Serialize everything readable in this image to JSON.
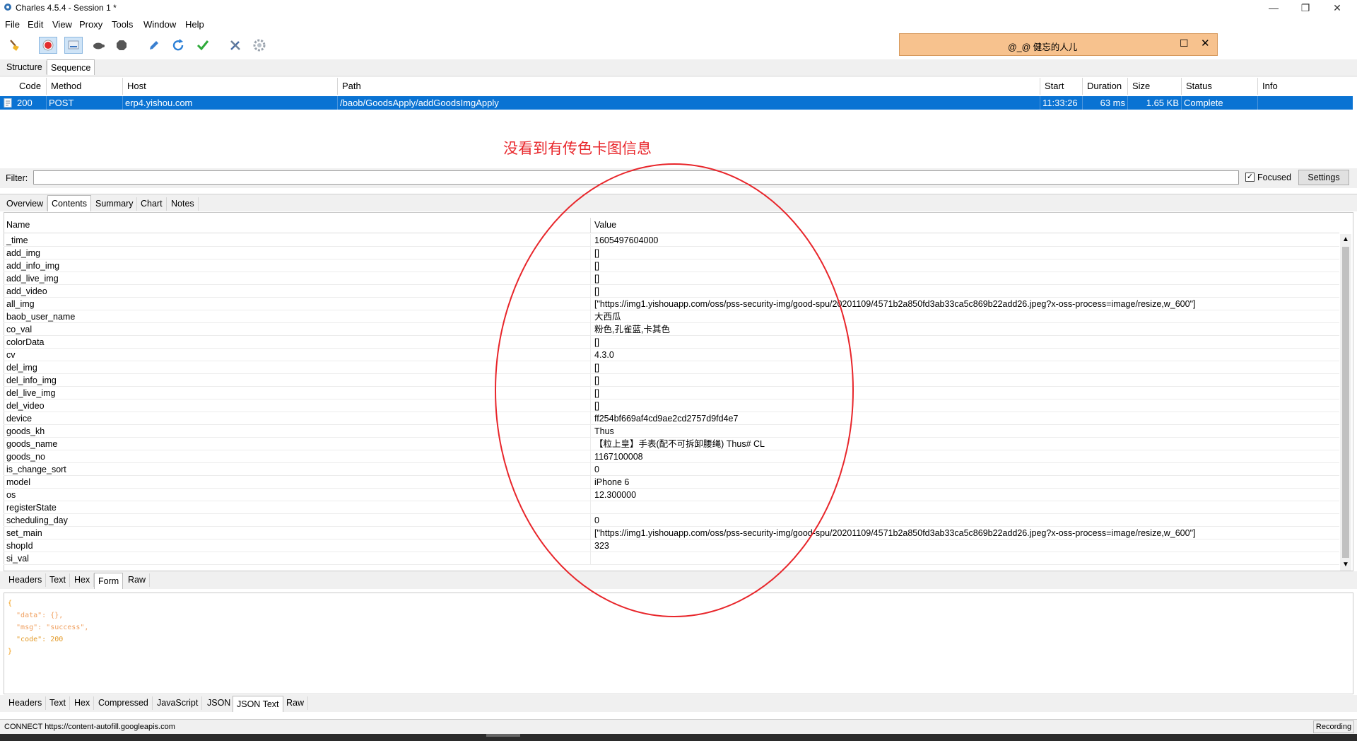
{
  "window": {
    "title": "Charles 4.5.4 - Session 1 *"
  },
  "menu": [
    "File",
    "Edit",
    "View",
    "Proxy",
    "Tools",
    "Window",
    "Help"
  ],
  "popup": {
    "text": "@_@   健忘的人儿"
  },
  "view_tabs": [
    "Structure",
    "Sequence"
  ],
  "table": {
    "headers": [
      "Code",
      "Method",
      "Host",
      "Path",
      "Start",
      "Duration",
      "Size",
      "Status",
      "Info"
    ],
    "row": {
      "code": "200",
      "method": "POST",
      "host": "erp4.yishou.com",
      "path": "/baob/GoodsApply/addGoodsImgApply",
      "start": "11:33:26",
      "duration": "63 ms",
      "size": "1.65 KB",
      "status": "Complete",
      "info": ""
    }
  },
  "annotation": {
    "text": "没看到有传色卡图信息",
    "color": "#e8262b"
  },
  "filter": {
    "label": "Filter:",
    "value": "",
    "focused_label": "Focused",
    "focused_checked": true,
    "settings_label": "Settings"
  },
  "detail_tabs": [
    "Overview",
    "Contents",
    "Summary",
    "Chart",
    "Notes"
  ],
  "nv_headers": {
    "name": "Name",
    "value": "Value"
  },
  "params": [
    {
      "name": "_time",
      "value": "1605497604000"
    },
    {
      "name": "add_img",
      "value": "[]"
    },
    {
      "name": "add_info_img",
      "value": "[]"
    },
    {
      "name": "add_live_img",
      "value": "[]"
    },
    {
      "name": "add_video",
      "value": "[]"
    },
    {
      "name": "all_img",
      "value": "[\"https://img1.yishouapp.com/oss/pss-security-img/good-spu/20201109/4571b2a850fd3ab33ca5c869b22add26.jpeg?x-oss-process=image/resize,w_600\"]"
    },
    {
      "name": "baob_user_name",
      "value": "大西瓜"
    },
    {
      "name": "co_val",
      "value": "粉色,孔雀蓝,卡其色"
    },
    {
      "name": "colorData",
      "value": "[]"
    },
    {
      "name": "cv",
      "value": "4.3.0"
    },
    {
      "name": "del_img",
      "value": "[]"
    },
    {
      "name": "del_info_img",
      "value": "[]"
    },
    {
      "name": "del_live_img",
      "value": "[]"
    },
    {
      "name": "del_video",
      "value": "[]"
    },
    {
      "name": "device",
      "value": "ff254bf669af4cd9ae2cd2757d9fd4e7"
    },
    {
      "name": "goods_kh",
      "value": "Thus"
    },
    {
      "name": "goods_name",
      "value": "【粒上皇】手表(配不可拆卸腰绳)  Thus#  CL"
    },
    {
      "name": "goods_no",
      "value": "1167100008"
    },
    {
      "name": "is_change_sort",
      "value": "0"
    },
    {
      "name": "model",
      "value": "iPhone 6"
    },
    {
      "name": "os",
      "value": "12.300000"
    },
    {
      "name": "registerState",
      "value": ""
    },
    {
      "name": "scheduling_day",
      "value": "0"
    },
    {
      "name": "set_main",
      "value": "[\"https://img1.yishouapp.com/oss/pss-security-img/good-spu/20201109/4571b2a850fd3ab33ca5c869b22add26.jpeg?x-oss-process=image/resize,w_600\"]"
    },
    {
      "name": "shopId",
      "value": "323"
    },
    {
      "name": "si_val",
      "value": ""
    }
  ],
  "request_tabs": [
    "Headers",
    "Text",
    "Hex",
    "Form",
    "Raw"
  ],
  "response_json": [
    "{",
    "  \"data\": {},",
    "  \"msg\": \"success\",",
    "  \"code\": 200",
    "}"
  ],
  "response_tabs": [
    "Headers",
    "Text",
    "Hex",
    "Compressed",
    "JavaScript",
    "JSON",
    "JSON Text",
    "Raw"
  ],
  "status": {
    "left": "CONNECT https://content-autofill.googleapis.com",
    "right": "Recording"
  }
}
